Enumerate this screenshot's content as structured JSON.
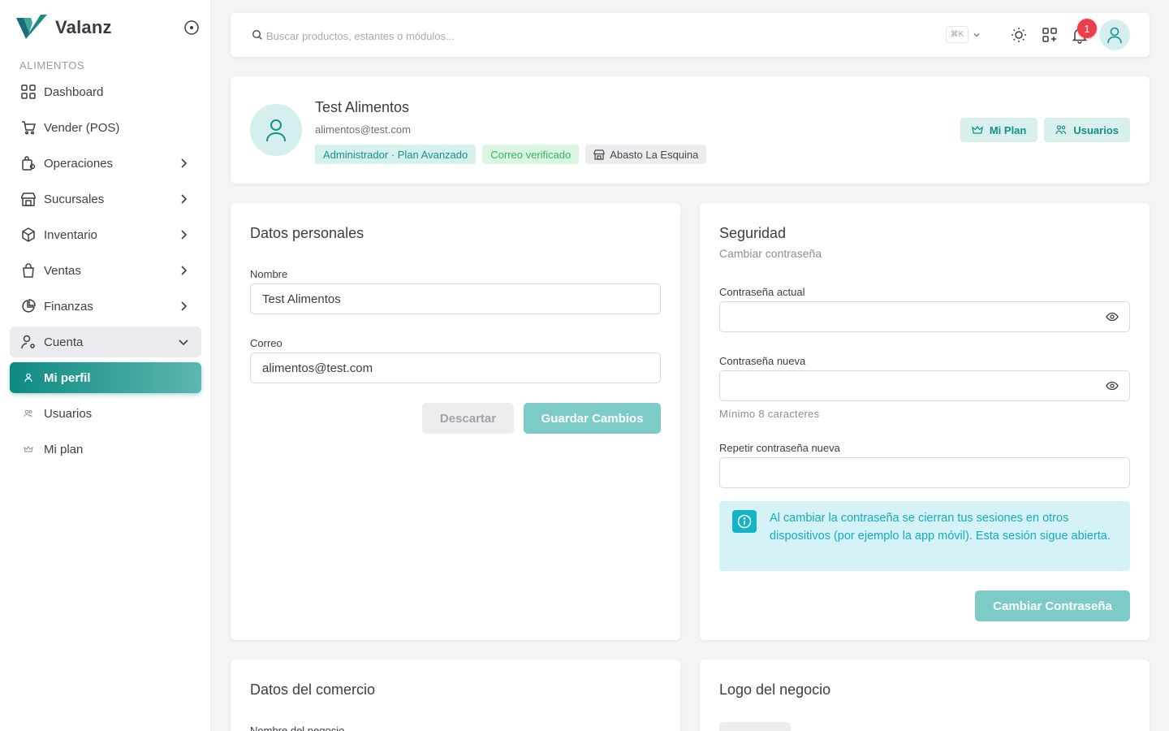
{
  "brand": {
    "name": "Valanz"
  },
  "sidebar": {
    "section_label": "ALIMENTOS",
    "items": [
      {
        "label": "Dashboard",
        "icon": "dashboard-icon"
      },
      {
        "label": "Vender (POS)",
        "icon": "cart-icon"
      },
      {
        "label": "Operaciones",
        "icon": "operations-icon"
      },
      {
        "label": "Sucursales",
        "icon": "store-icon"
      },
      {
        "label": "Inventario",
        "icon": "box-icon"
      },
      {
        "label": "Ventas",
        "icon": "bag-icon"
      },
      {
        "label": "Finanzas",
        "icon": "pie-chart-icon"
      },
      {
        "label": "Cuenta",
        "icon": "user-settings-icon"
      },
      {
        "label": "Mi perfil",
        "icon": "user-icon"
      },
      {
        "label": "Usuarios",
        "icon": "users-icon"
      },
      {
        "label": "Mi plan",
        "icon": "crown-icon"
      }
    ]
  },
  "search": {
    "placeholder": "Buscar productos, estantes o módulos...",
    "shortcut": "⌘K"
  },
  "topbar": {
    "notification_count": "1"
  },
  "profile": {
    "name": "Test Alimentos",
    "email": "alimentos@test.com",
    "badges": {
      "role": "Administrador · Plan Avanzado",
      "verified": "Correo verificado",
      "store": "Abasto La Esquina"
    },
    "actions": {
      "plan": "Mi Plan",
      "users": "Usuarios"
    }
  },
  "personal": {
    "title": "Datos personales",
    "name_label": "Nombre",
    "name_value": "Test Alimentos",
    "email_label": "Correo",
    "email_value": "alimentos@test.com",
    "discard": "Descartar",
    "save": "Guardar Cambios"
  },
  "security": {
    "title": "Seguridad",
    "subtitle": "Cambiar contraseña",
    "current_label": "Contraseña actual",
    "new_label": "Contraseña nueva",
    "hint": "Mínimo 8 caracteres",
    "repeat_label": "Repetir contraseña nueva",
    "info": "Al cambiar la contraseña se cierran tus sesiones en otros dispositivos (por ejemplo la app móvil). Esta sesión sigue abierta.",
    "change_button": "Cambiar Contraseña"
  },
  "store": {
    "title": "Datos del comercio",
    "name_label": "Nombre del negocio"
  },
  "logo": {
    "title": "Logo del negocio"
  },
  "colors": {
    "accent": "#14928a",
    "active_nav_start": "#0e8a83",
    "active_nav_end": "#5cb7b0",
    "badge_red": "#ef3d4a",
    "info": "#15aabe"
  }
}
